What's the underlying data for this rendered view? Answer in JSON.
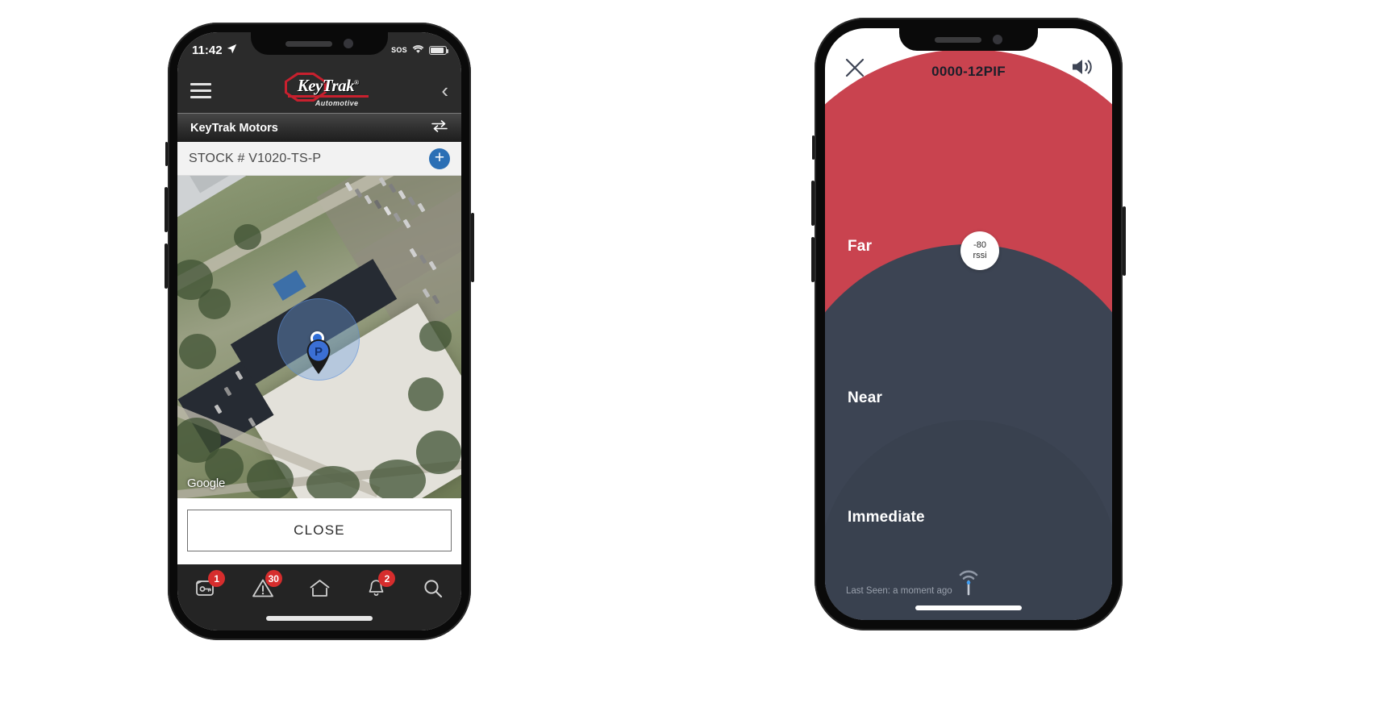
{
  "left_phone": {
    "status_bar": {
      "time": "11:42",
      "location_icon": "location-arrow-icon",
      "carrier": "SOS",
      "wifi_icon": "wifi-icon",
      "battery_icon": "battery-icon"
    },
    "app_header": {
      "menu_icon": "hamburger-menu-icon",
      "logo_text": "KeyTrak",
      "logo_registered": "®",
      "logo_subtitle": "Automotive",
      "back_icon": "chevron-left-icon"
    },
    "sub_header": {
      "title": "KeyTrak Motors",
      "swap_icon": "swap-horizontal-icon"
    },
    "stock_bar": {
      "label": "STOCK # V1020-TS-P",
      "add_icon": "plus-circle-icon",
      "add_color": "#2b6fb5"
    },
    "map": {
      "attribution": "Google",
      "current_location_icon": "blue-location-dot",
      "parking_marker_label": "P",
      "marker_color": "#2f6ed8"
    },
    "close_button": {
      "label": "CLOSE"
    },
    "tab_bar": {
      "items": [
        {
          "name": "keys",
          "icon": "key-card-icon",
          "badge": "1"
        },
        {
          "name": "alerts",
          "icon": "warning-triangle-icon",
          "badge": "30"
        },
        {
          "name": "home",
          "icon": "home-icon",
          "badge": ""
        },
        {
          "name": "notifications",
          "icon": "bell-icon",
          "badge": "2"
        },
        {
          "name": "search",
          "icon": "search-icon",
          "badge": ""
        }
      ],
      "badge_color": "#d62d2d"
    }
  },
  "right_phone": {
    "header": {
      "close_icon": "close-x-icon",
      "title": "0000-12PIF",
      "speaker_icon": "speaker-volume-icon"
    },
    "zones": [
      {
        "label": "Far",
        "color": "#c9434f"
      },
      {
        "label": "Near",
        "color": "#3c4453"
      },
      {
        "label": "Immediate",
        "color": "#39414f"
      }
    ],
    "rssi": {
      "value": "-80",
      "unit": "rssi"
    },
    "footer": {
      "last_seen": "Last Seen: a moment ago",
      "beacon_icon": "beacon-signal-icon"
    }
  }
}
